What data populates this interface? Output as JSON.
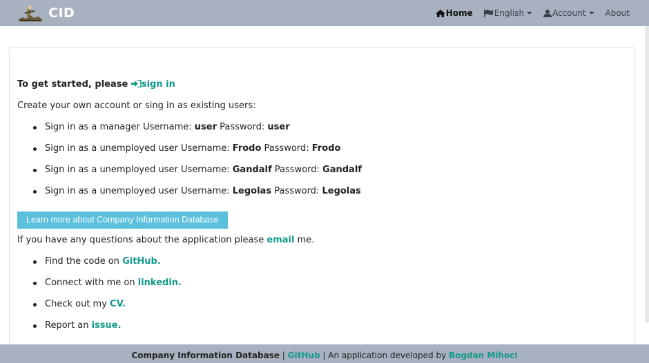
{
  "navbar": {
    "brand": "CID",
    "home": "Home",
    "language": "English",
    "account": "Account",
    "about": "About"
  },
  "main": {
    "getting_started_prefix": "To get started, please",
    "sign_in_link": "sign in",
    "create_account_text": "Create your own account or sing in as existing users:",
    "users": [
      {
        "prefix": "Sign in as a manager Username:",
        "username": "user",
        "pw_label": "Password:",
        "password": "user"
      },
      {
        "prefix": "Sign in as a unemployed user Username:",
        "username": "Frodo",
        "pw_label": "Password:",
        "password": "Frodo"
      },
      {
        "prefix": "Sign in as a unemployed user Username:",
        "username": "Gandalf",
        "pw_label": "Password:",
        "password": "Gandalf"
      },
      {
        "prefix": "Sign in as a unemployed user Username:",
        "username": "Legolas",
        "pw_label": "Password:",
        "password": "Legolas"
      }
    ],
    "learn_more_button": "Learn more about Company Information Database",
    "questions_prefix": "If you have any questions about the application please",
    "email_link": "email",
    "questions_suffix": "me.",
    "links": [
      {
        "prefix": "Find the code on",
        "link": "GitHub."
      },
      {
        "prefix": "Connect with me on",
        "link": "linkedin."
      },
      {
        "prefix": "Check out my",
        "link": "CV."
      },
      {
        "prefix": "Report an",
        "link": "issue."
      }
    ]
  },
  "footer": {
    "app_name": "Company Information Database",
    "sep1": "|",
    "github_link": "GitHub",
    "sep2": "|",
    "developed_by": "An application developed by",
    "author_link": "Bogdan Mihoci"
  },
  "colors": {
    "navbar_bg": "#a7b1bf",
    "link": "#139a8c",
    "info_button": "#5bc0de"
  }
}
